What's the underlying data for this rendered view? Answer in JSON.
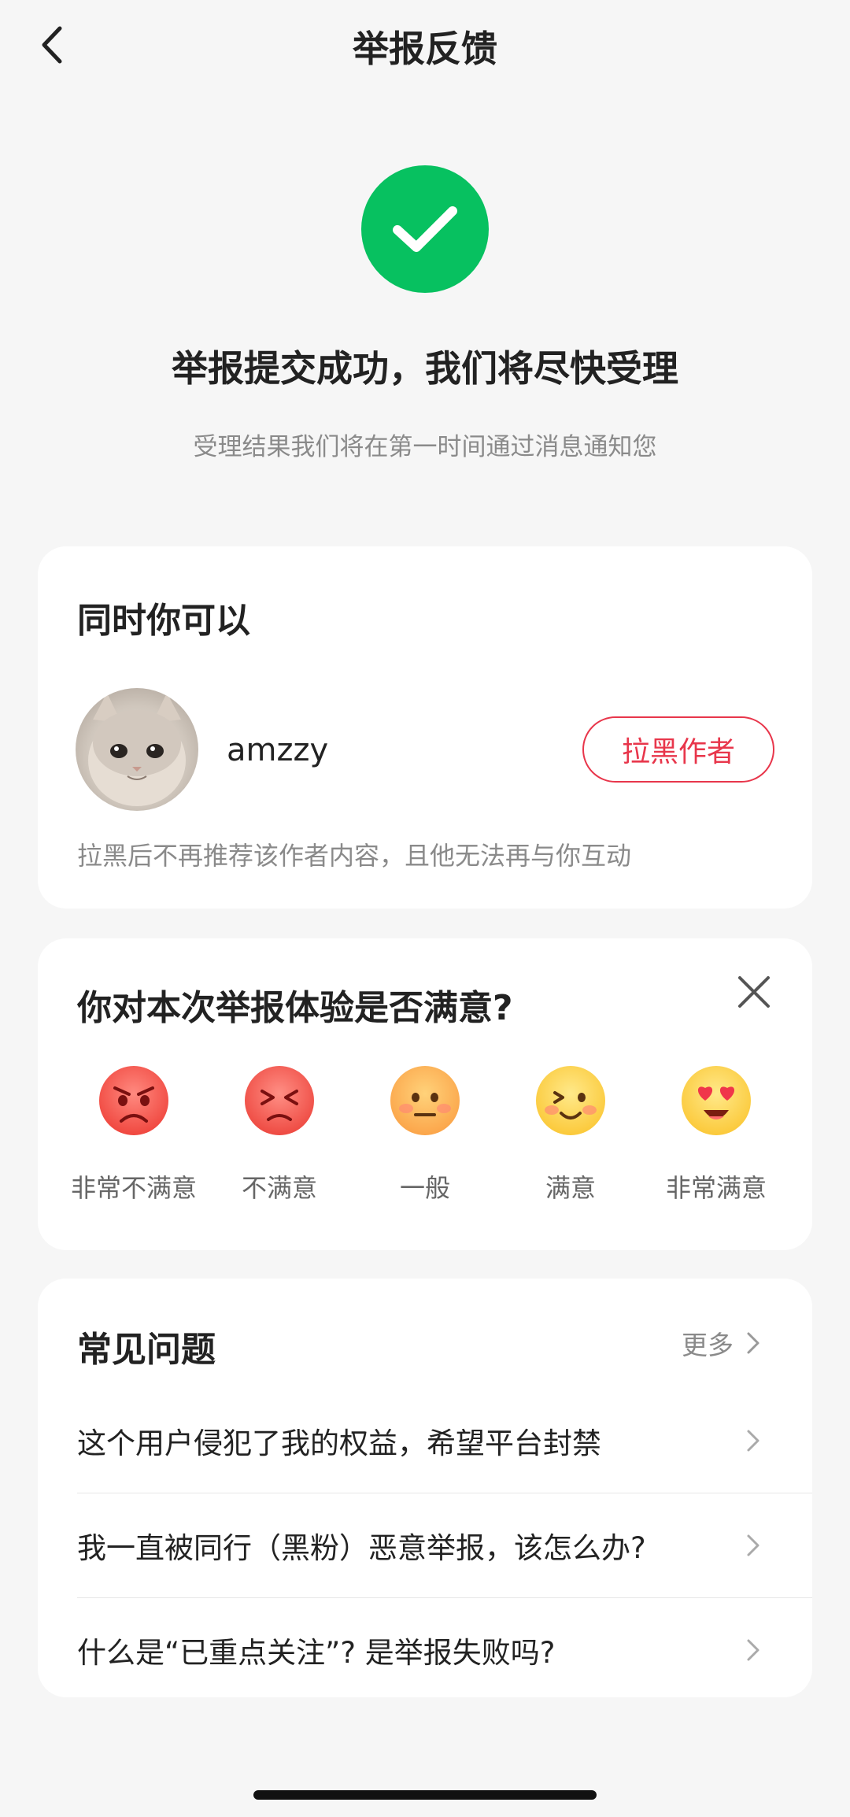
{
  "header": {
    "title": "举报反馈"
  },
  "success": {
    "title": "举报提交成功，我们将尽快受理",
    "subtitle": "受理结果我们将在第一时间通过消息通知您",
    "icon": "check-circle-icon",
    "color": "#07c160"
  },
  "actions_card": {
    "heading": "同时你可以",
    "user": {
      "name": "amzzy"
    },
    "block_button": "拉黑作者",
    "hint": "拉黑后不再推荐该作者内容，且他无法再与你互动",
    "accent_color": "#e8364b"
  },
  "survey": {
    "question": "你对本次举报体验是否满意?",
    "options": [
      {
        "label": "非常不满意",
        "icon": "very-dissatisfied-emoji-icon"
      },
      {
        "label": "不满意",
        "icon": "dissatisfied-emoji-icon"
      },
      {
        "label": "一般",
        "icon": "neutral-emoji-icon"
      },
      {
        "label": "满意",
        "icon": "satisfied-emoji-icon"
      },
      {
        "label": "非常满意",
        "icon": "very-satisfied-emoji-icon"
      }
    ]
  },
  "faq": {
    "heading": "常见问题",
    "more": "更多",
    "items": [
      "这个用户侵犯了我的权益，希望平台封禁",
      "我一直被同行（黑粉）恶意举报，该怎么办?",
      "什么是“已重点关注”? 是举报失败吗?"
    ]
  }
}
